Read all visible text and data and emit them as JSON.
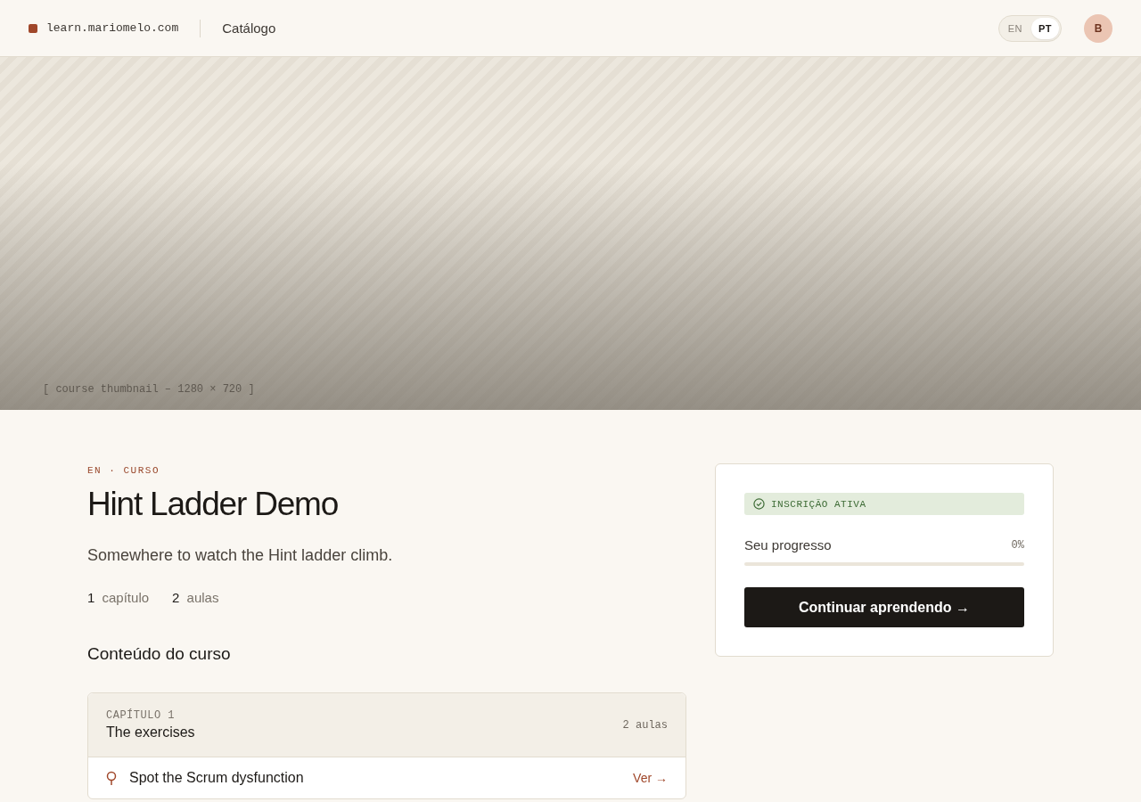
{
  "header": {
    "site": "learn.mariomelo.com",
    "nav": [
      {
        "label": "Catálogo"
      }
    ],
    "language_toggle": [
      {
        "label": "EN",
        "selected": false
      },
      {
        "label": "PT",
        "selected": true
      }
    ],
    "avatar": "B"
  },
  "hero": {
    "caption": "[ course thumbnail – 1280 × 720 ]"
  },
  "course": {
    "eyebrow": "EN · CURSO",
    "title": "Hint Ladder Demo",
    "description": "Somewhere to watch the Hint ladder climb.",
    "stats": [
      {
        "count": "1",
        "unit": "capítulo"
      },
      {
        "count": "2",
        "unit": "aulas"
      }
    ]
  },
  "contents": {
    "heading": "Conteúdo do curso",
    "chapters": [
      {
        "label": "CAPÍTULO 1",
        "title": "The exercises",
        "count": "2 aulas",
        "lessons": [
          {
            "title": "Spot the Scrum dysfunction",
            "action": "Ver →"
          }
        ]
      }
    ]
  },
  "enrollment": {
    "badge": "INSCRIÇÃO ATIVA",
    "progress_label": "Seu progresso",
    "progress_reading": "0%",
    "level": 0,
    "button": "Continuar aprendendo →"
  }
}
